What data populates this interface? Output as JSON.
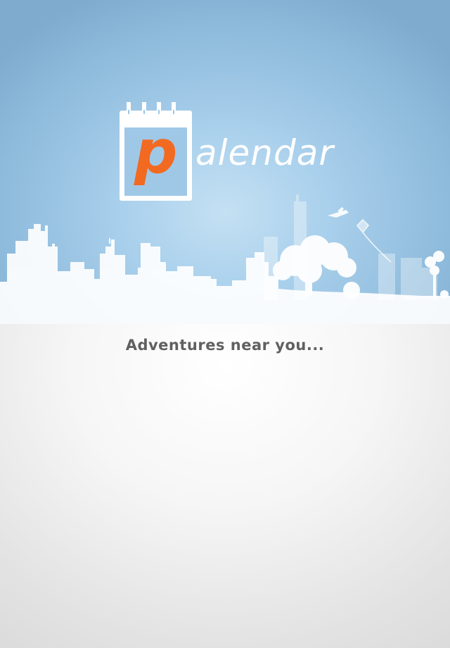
{
  "app": {
    "logo_letter": "p",
    "logo_word": "alendar",
    "tagline": "Adventures near you..."
  },
  "icons": {
    "logo": "calendar-icon",
    "skyline": "city-skyline-silhouette",
    "airplane": "airplane-icon",
    "kite": "kite-icon",
    "tree": "tree-icon"
  },
  "colors": {
    "sky": "#9cc6e6",
    "logo_p": "#f26a21",
    "background": "#ececec",
    "tagline": "#606060"
  }
}
